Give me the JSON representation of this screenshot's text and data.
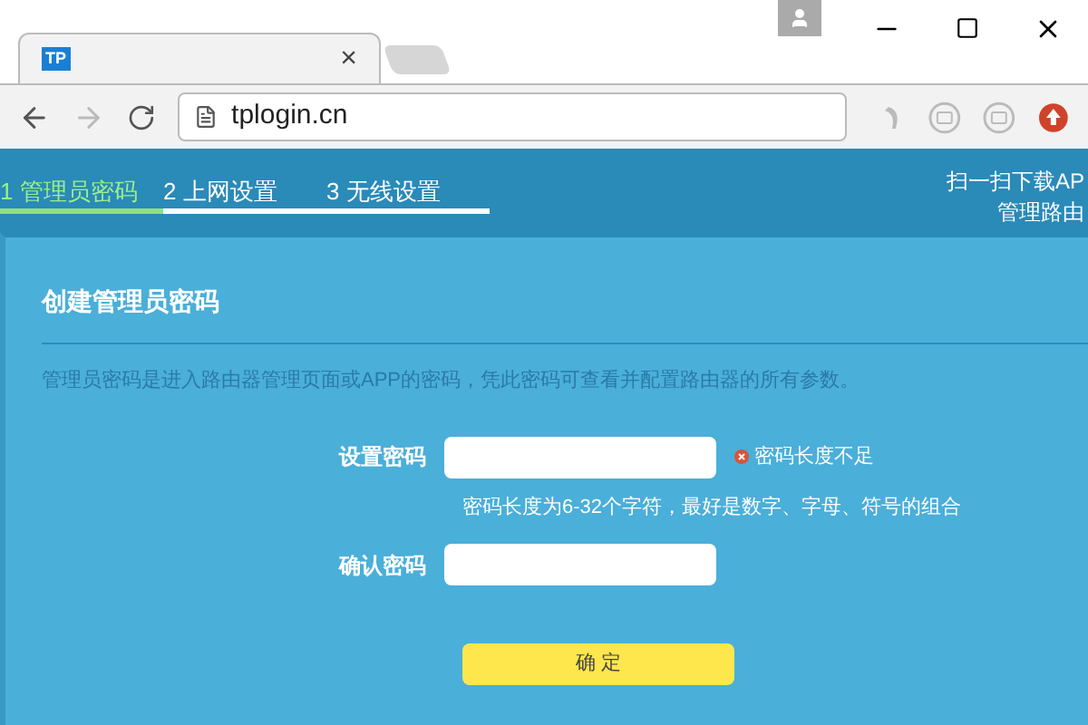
{
  "browser": {
    "tab": {
      "favicon": "TP",
      "close": "×"
    },
    "url": "tplogin.cn"
  },
  "header": {
    "steps": [
      {
        "label": "1 管理员密码",
        "selected": true
      },
      {
        "label": "2 上网设置",
        "selected": false
      },
      {
        "label": "3 无线设置",
        "selected": false
      }
    ],
    "promo": [
      "扫一扫下载AP",
      "管理路由"
    ]
  },
  "form": {
    "title": "创建管理员密码",
    "description": "管理员密码是进入路由器管理页面或APP的密码，凭此密码可查看并配置路由器的所有参数。",
    "fields": [
      {
        "label": "设置密码",
        "error": "密码长度不足",
        "hint": "密码长度为6-32个字符，最好是数字、字母、符号的组合"
      },
      {
        "label": "确认密码"
      }
    ],
    "submit": "确 定"
  }
}
